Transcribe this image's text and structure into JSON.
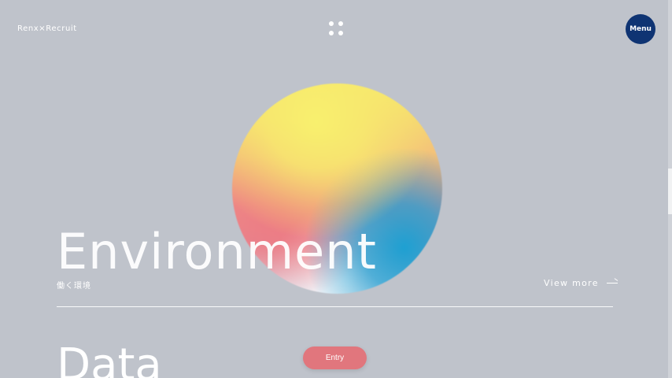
{
  "header": {
    "logo_text": "Renx×Recruit",
    "menu_label": "Menu"
  },
  "hero": {
    "section_title": "Environment",
    "section_subtitle": "働く環境",
    "view_more_label": "View more"
  },
  "next_section": {
    "title": "Data"
  },
  "cta": {
    "entry_label": "Entry"
  },
  "colors": {
    "background": "#bfc3cb",
    "menu_button": "#0f3473",
    "entry_button": "#e1767d",
    "text": "#ffffff"
  }
}
